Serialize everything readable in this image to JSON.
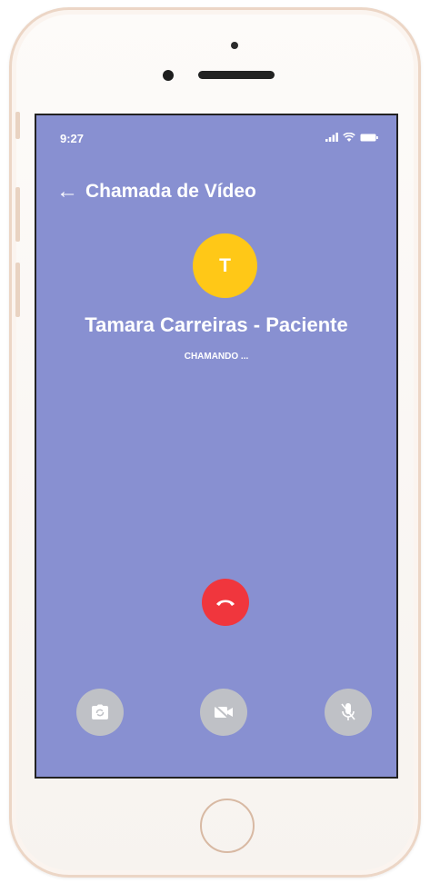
{
  "status_bar": {
    "time": "9:27",
    "icons": [
      "signal-icon",
      "wifi-icon",
      "battery-icon"
    ]
  },
  "header": {
    "back_icon": "arrow-left-icon",
    "back_glyph": "←",
    "title": "Chamada de Vídeo"
  },
  "contact": {
    "initial": "T",
    "name": "Tamara Carreiras - Paciente",
    "avatar_color": "#ffc817"
  },
  "call": {
    "status": "CHAMANDO ..."
  },
  "controls": {
    "hangup_icon": "hangup-icon",
    "hangup_color": "#f0363d",
    "switch_camera_icon": "switch-camera-icon",
    "video_off_icon": "video-off-icon",
    "mic_off_icon": "mic-off-icon",
    "disabled_color": "#bfc1c6"
  },
  "colors": {
    "screen_bg": "#8890d1"
  }
}
